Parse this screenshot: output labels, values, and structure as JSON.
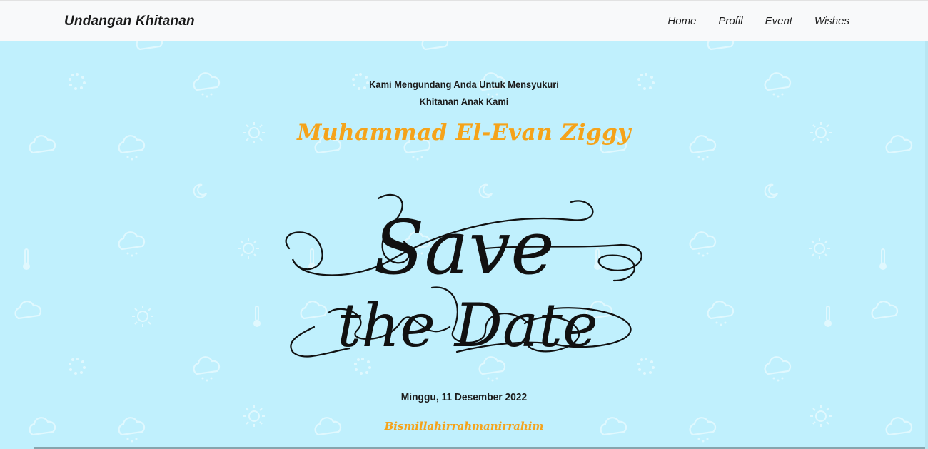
{
  "navbar": {
    "brand": "Undangan Khitanan",
    "links": [
      "Home",
      "Profil",
      "Event",
      "Wishes"
    ]
  },
  "hero": {
    "intro_line1": "Kami Mengundang Anda Untuk Mensyukuri",
    "intro_line2": "Khitanan Anak Kami",
    "child_name": "Muhammad El-Evan Ziggy",
    "save_the_date_line1": "Save",
    "save_the_date_line2": "the Date",
    "event_date": "Minggu, 11 Desember 2022",
    "greeting": "Bismillahirrahmanirrahim"
  },
  "colors": {
    "background": "#c0f0fd",
    "accent": "#f5a31a",
    "navbar": "#f8f9fa"
  }
}
